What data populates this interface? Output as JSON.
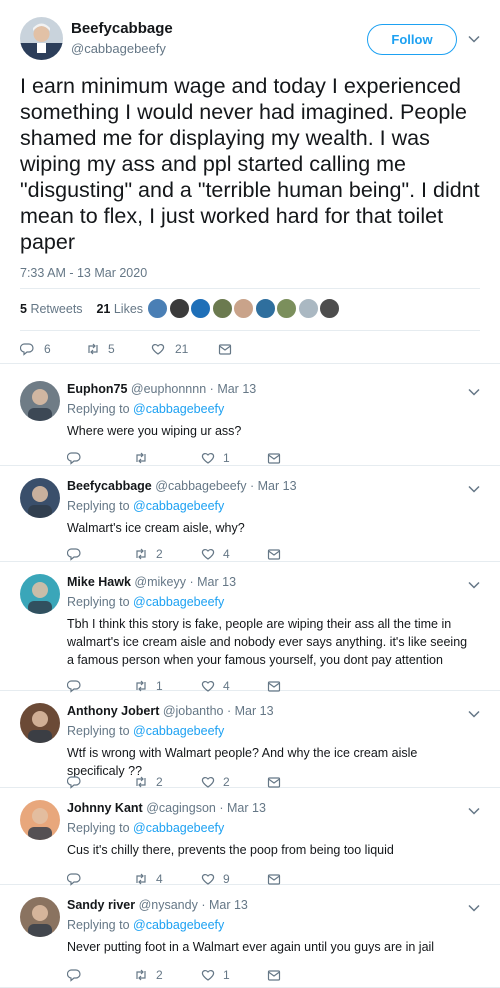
{
  "tweet": {
    "display_name": "Beefycabbage",
    "handle": "@cabbagebeefy",
    "follow_label": "Follow",
    "text": "I earn minimum wage and today I experienced something I would never had imagined. People shamed me for displaying my wealth. I was wiping my ass and ppl started calling me \"disgusting\" and a \"terrible human being\". I didnt mean to flex, I just worked hard for that toilet paper",
    "timestamp": "7:33 AM - 13 Mar 2020",
    "retweets_count": "5",
    "retweets_label": "Retweets",
    "likes_count": "21",
    "likes_label": "Likes",
    "actions": {
      "replies": "6",
      "retweets": "5",
      "likes": "21"
    }
  },
  "likers": [
    "#4a7fb5",
    "#3b3b3b",
    "#1e6fb8",
    "#6b7a4f",
    "#c9a38a",
    "#2f6f9e",
    "#7b8f5c",
    "#aab8c2",
    "#4d4d4d"
  ],
  "colors": {
    "accent": "#1da1f2",
    "text": "#14171a",
    "secondary": "#657786",
    "border": "#e6ecf0"
  },
  "replies": [
    {
      "name": "Euphon75",
      "handle": "@euphonnnn",
      "sep": "·",
      "date": "Mar 13",
      "replying_label": "Replying to",
      "replying_to": "@cabbagebeefy",
      "text": "Where were you wiping ur ass?",
      "replies": "",
      "retweets": "",
      "likes": "1",
      "avatar_color": "#6f7c86"
    },
    {
      "name": "Beefycabbage",
      "handle": "@cabbagebeefy",
      "sep": "·",
      "date": "Mar 13",
      "replying_label": "Replying to",
      "replying_to": "@cabbagebeefy",
      "text": "Walmart's ice cream aisle, why?",
      "replies": "",
      "retweets": "2",
      "likes": "4",
      "avatar_color": "#3a4f6b"
    },
    {
      "name": "Mike Hawk",
      "handle": "@mikeyy",
      "sep": "·",
      "date": "Mar 13",
      "replying_label": "Replying to",
      "replying_to": "@cabbagebeefy",
      "text": "Tbh I think this story is fake, people are wiping their ass all the time in walmart's ice cream aisle and nobody ever says anything. it's like seeing a famous person when your famous yourself, you dont pay attention",
      "replies": "",
      "retweets": "1",
      "likes": "4",
      "avatar_color": "#3aa6b9"
    },
    {
      "name": "Anthony Jobert",
      "handle": "@jobantho",
      "sep": "·",
      "date": "Mar 13",
      "replying_label": "Replying to",
      "replying_to": "@cabbagebeefy",
      "text": "Wtf is wrong with Walmart people? And why the ice cream aisle specificaly ??",
      "replies": "",
      "retweets": "2",
      "likes": "2",
      "avatar_color": "#6b4a36"
    },
    {
      "name": "Johnny Kant",
      "handle": "@cagingson",
      "sep": "·",
      "date": "Mar 13",
      "replying_label": "Replying to",
      "replying_to": "@cabbagebeefy",
      "text": "Cus it's chilly there, prevents the poop from being too liquid",
      "replies": "",
      "retweets": "4",
      "likes": "9",
      "avatar_color": "#e8a77c"
    },
    {
      "name": "Sandy river",
      "handle": "@nysandy",
      "sep": "·",
      "date": "Mar 13",
      "replying_label": "Replying to",
      "replying_to": "@cabbagebeefy",
      "text": "Never putting foot in a Walmart ever again until you guys are in jail",
      "replies": "",
      "retweets": "2",
      "likes": "1",
      "avatar_color": "#8a7360"
    }
  ]
}
